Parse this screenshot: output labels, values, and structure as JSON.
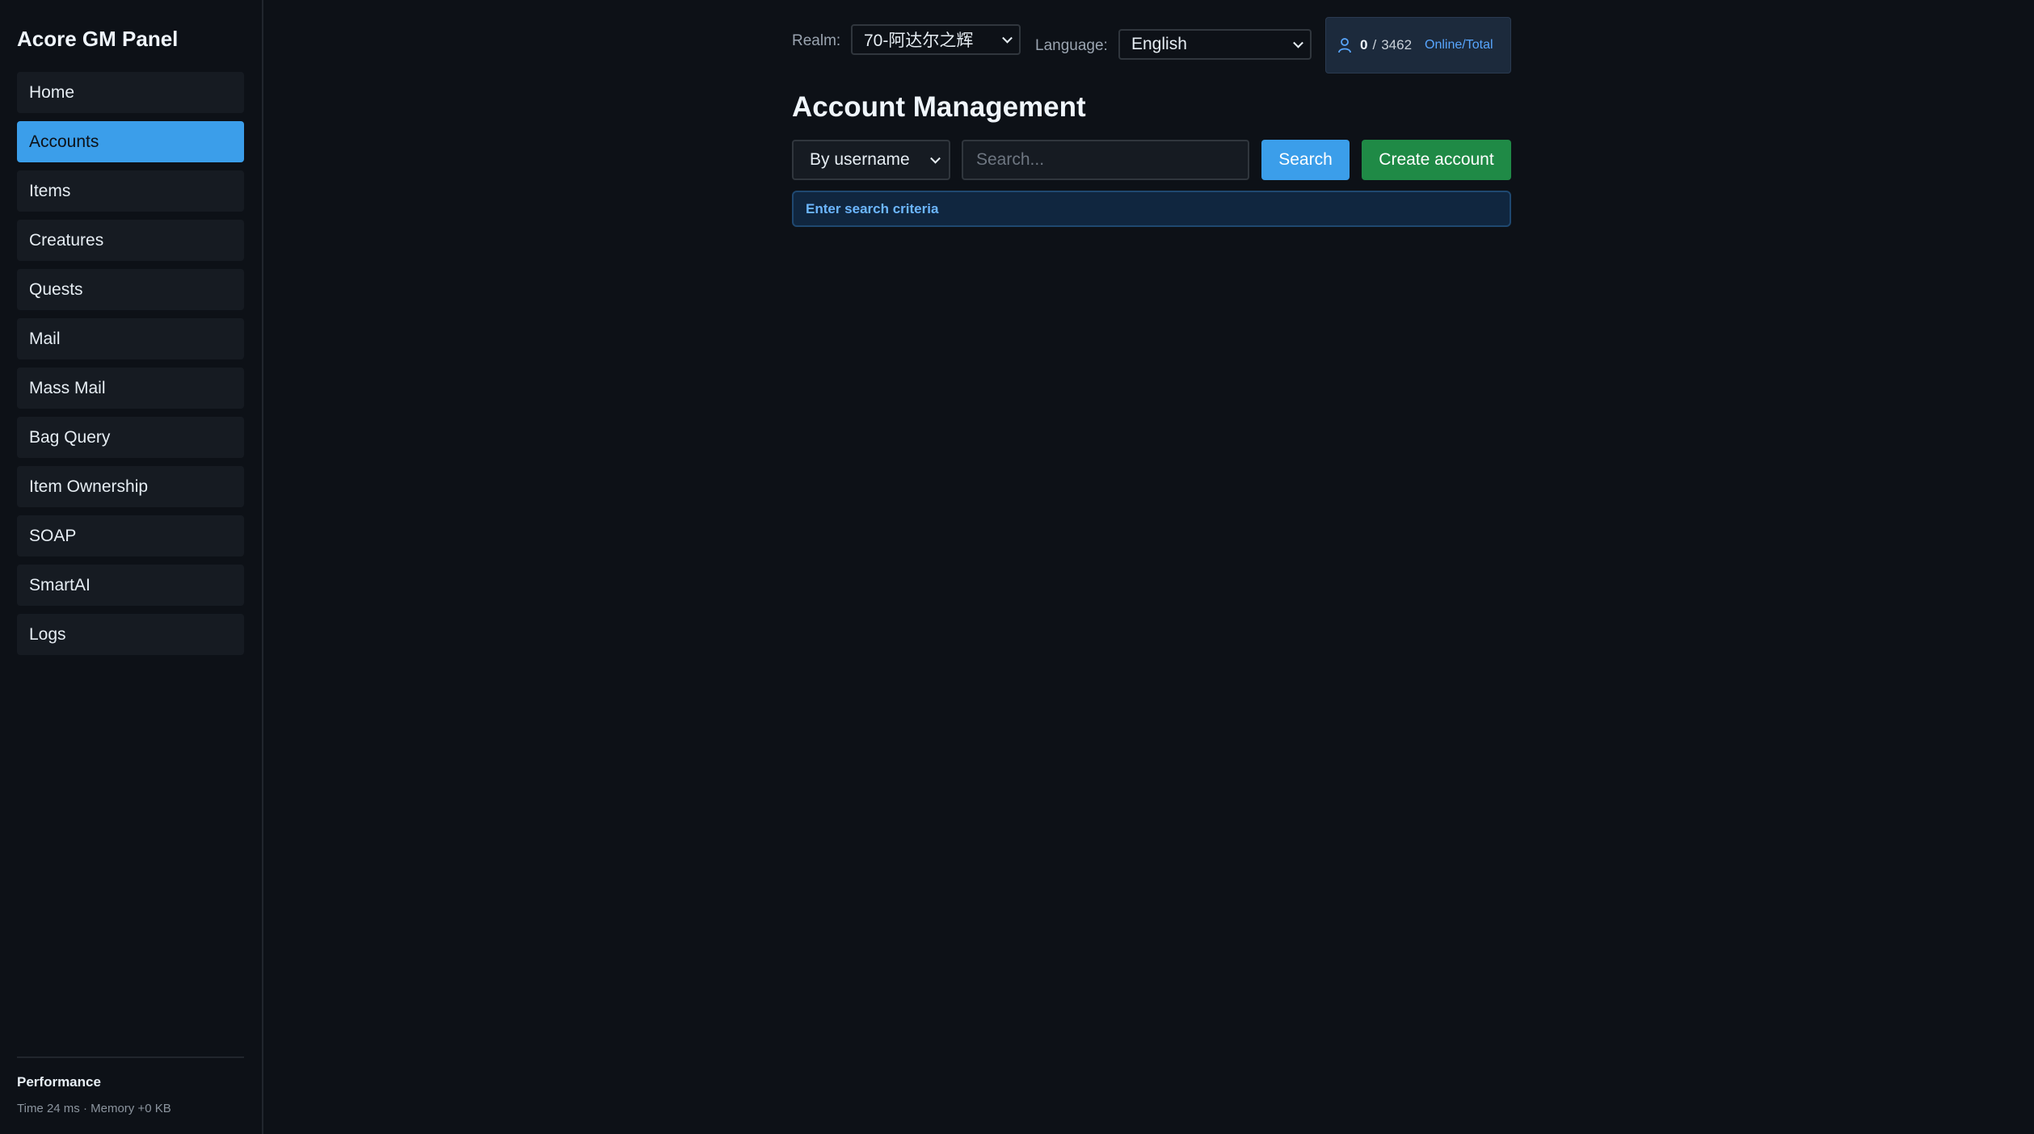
{
  "app": {
    "title": "Acore GM Panel"
  },
  "sidebar": {
    "items": [
      {
        "label": "Home",
        "active": false
      },
      {
        "label": "Accounts",
        "active": true
      },
      {
        "label": "Items",
        "active": false
      },
      {
        "label": "Creatures",
        "active": false
      },
      {
        "label": "Quests",
        "active": false
      },
      {
        "label": "Mail",
        "active": false
      },
      {
        "label": "Mass Mail",
        "active": false
      },
      {
        "label": "Bag Query",
        "active": false
      },
      {
        "label": "Item Ownership",
        "active": false
      },
      {
        "label": "SOAP",
        "active": false
      },
      {
        "label": "SmartAI",
        "active": false
      },
      {
        "label": "Logs",
        "active": false
      }
    ],
    "performance": {
      "title": "Performance",
      "stats": "Time 24 ms · Memory +0 KB"
    }
  },
  "header": {
    "realm_label": "Realm:",
    "realm_value": "70-阿达尔之辉",
    "language_label": "Language:",
    "language_value": "English",
    "online": "0",
    "separator": "/",
    "total": "3462",
    "stats_caption": "Online/Total"
  },
  "main": {
    "title": "Account Management",
    "filter_value": "By username",
    "search_placeholder": "Search...",
    "search_button": "Search",
    "create_button": "Create account",
    "hint": "Enter search criteria"
  },
  "colors": {
    "background": "#0d1117",
    "accent": "#3b9eea",
    "create": "#1f8a46",
    "hint_text": "#6cb6ff"
  },
  "icons": {
    "stats": "user-icon"
  }
}
